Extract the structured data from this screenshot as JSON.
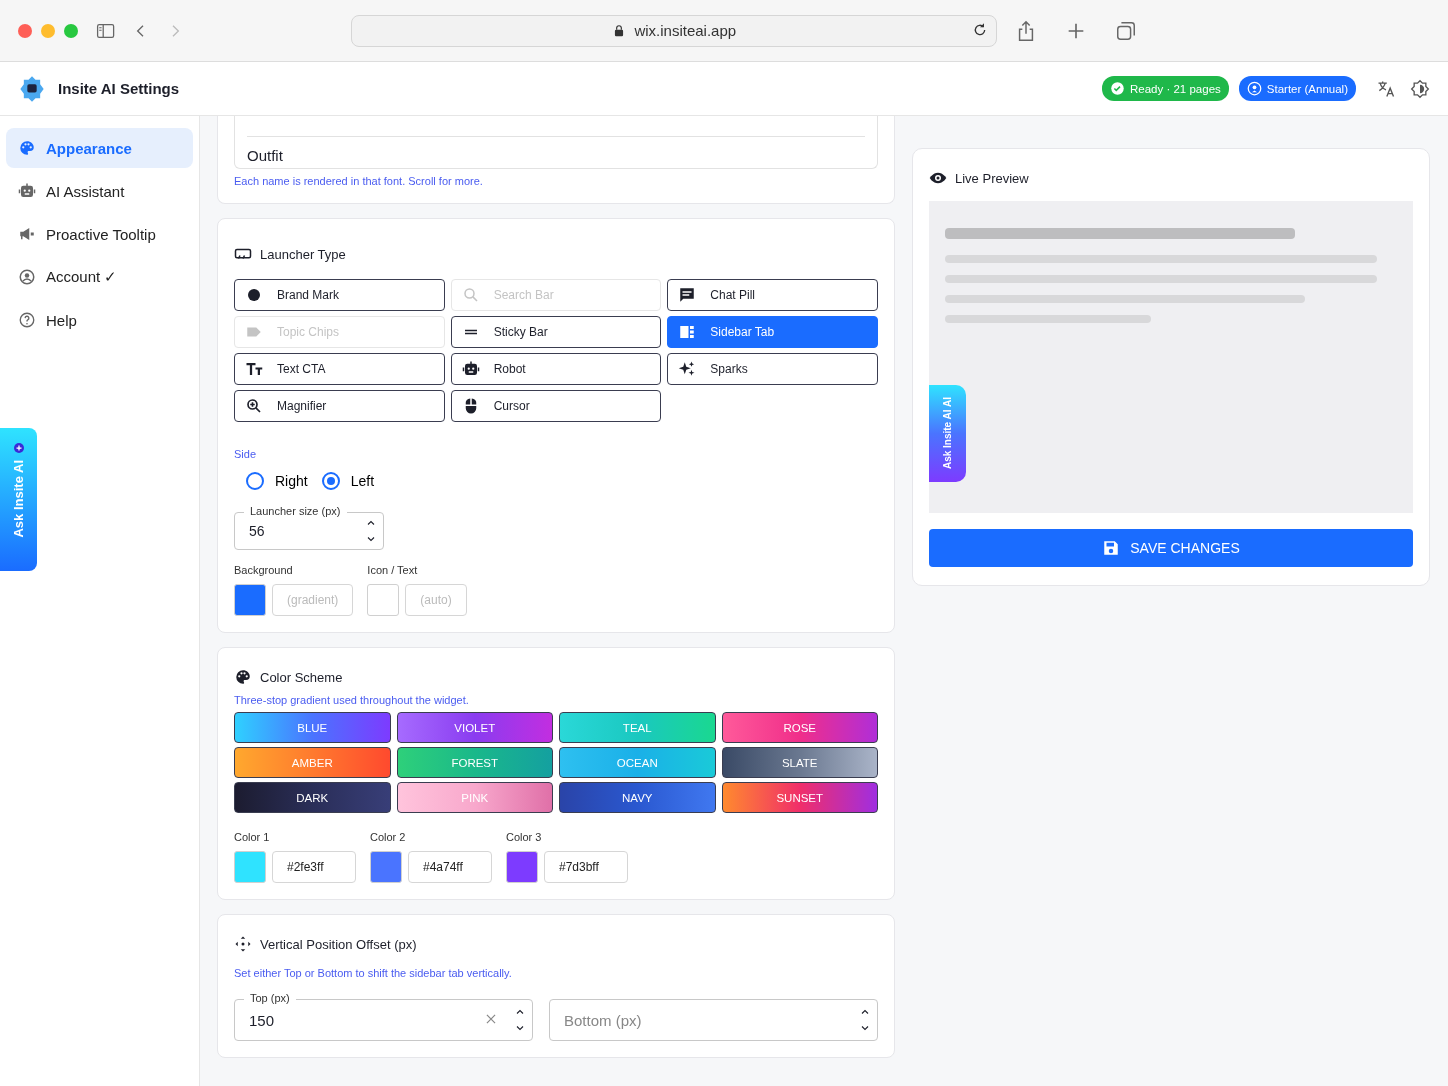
{
  "browser": {
    "url": "wix.insiteai.app"
  },
  "header": {
    "title": "Insite AI Settings",
    "badges": [
      {
        "label": "Ready · 21 pages",
        "kind": "ready"
      },
      {
        "label": "Starter (Annual)",
        "kind": "plan"
      }
    ]
  },
  "sidebar": {
    "items": [
      {
        "label": "Appearance",
        "kind": "palette",
        "selected": true
      },
      {
        "label": "AI Assistant",
        "kind": "robot",
        "selected": false
      },
      {
        "label": "Proactive Tooltip",
        "kind": "megaphone",
        "selected": false
      },
      {
        "label": "Account ✓",
        "kind": "account",
        "selected": false
      },
      {
        "label": "Help",
        "kind": "help",
        "selected": false
      }
    ]
  },
  "floating_tab": {
    "label": "Ask Insite AI"
  },
  "font_list": {
    "items": [
      "Outfit"
    ],
    "hint": "Each name is rendered in that font. Scroll for more."
  },
  "launcher": {
    "title": "Launcher Type",
    "options": [
      {
        "label": "Brand Mark",
        "kind": "dot",
        "selected": false,
        "disabled": false
      },
      {
        "label": "Search Bar",
        "kind": "search",
        "selected": false,
        "disabled": true
      },
      {
        "label": "Chat Pill",
        "kind": "chat",
        "selected": false,
        "disabled": false
      },
      {
        "label": "Topic Chips",
        "kind": "chip",
        "selected": false,
        "disabled": true
      },
      {
        "label": "Sticky Bar",
        "kind": "bars",
        "selected": false,
        "disabled": false
      },
      {
        "label": "Sidebar Tab",
        "kind": "sidebar",
        "selected": true,
        "disabled": false
      },
      {
        "label": "Text CTA",
        "kind": "text",
        "selected": false,
        "disabled": false
      },
      {
        "label": "Robot",
        "kind": "robot",
        "selected": false,
        "disabled": false
      },
      {
        "label": "Sparks",
        "kind": "sparks",
        "selected": false,
        "disabled": false
      },
      {
        "label": "Magnifier",
        "kind": "magnifier",
        "selected": false,
        "disabled": false
      },
      {
        "label": "Cursor",
        "kind": "mouse",
        "selected": false,
        "disabled": false
      }
    ],
    "side": {
      "label": "Side",
      "options": [
        {
          "label": "Right",
          "selected": false
        },
        {
          "label": "Left",
          "selected": true
        }
      ]
    },
    "size": {
      "label": "Launcher size (px)",
      "value": "56"
    },
    "colors": [
      {
        "label": "Background",
        "placeholder": "(gradient)",
        "color": "#1a6cff"
      },
      {
        "label": "Icon / Text",
        "placeholder": "(auto)",
        "color": "#ffffff"
      }
    ]
  },
  "color_scheme": {
    "title": "Color Scheme",
    "hint": "Three-stop gradient used throughout the widget.",
    "presets": [
      {
        "label": "BLUE"
      },
      {
        "label": "VIOLET"
      },
      {
        "label": "TEAL"
      },
      {
        "label": "ROSE"
      },
      {
        "label": "AMBER"
      },
      {
        "label": "FOREST"
      },
      {
        "label": "OCEAN"
      },
      {
        "label": "SLATE"
      },
      {
        "label": "DARK"
      },
      {
        "label": "PINK"
      },
      {
        "label": "NAVY"
      },
      {
        "label": "SUNSET"
      }
    ],
    "stops": [
      {
        "label": "Color 1",
        "value": "#2fe3ff",
        "color": "#2fe3ff"
      },
      {
        "label": "Color 2",
        "value": "#4a74ff",
        "color": "#4a74ff"
      },
      {
        "label": "Color 3",
        "value": "#7d3bff",
        "color": "#7d3bff"
      }
    ]
  },
  "offset": {
    "title": "Vertical Position Offset (px)",
    "hint": "Set either Top or Bottom to shift the sidebar tab vertically.",
    "top": {
      "label": "Top (px)",
      "value": "150"
    },
    "bottom": {
      "placeholder": "Bottom (px)"
    }
  },
  "preview": {
    "title": "Live Preview",
    "tab_label": "Ask Insite AI AI",
    "save": "SAVE CHANGES"
  }
}
